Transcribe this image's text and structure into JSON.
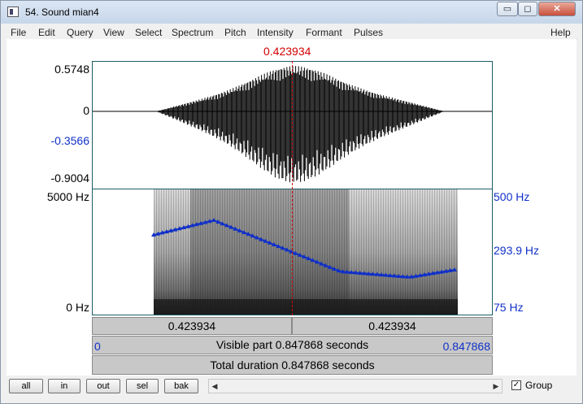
{
  "window": {
    "title": "54. Sound mian4",
    "minimize": "▭",
    "maximize": "◻",
    "close": "✕"
  },
  "menu": [
    "File",
    "Edit",
    "Query",
    "View",
    "Select",
    "Spectrum",
    "Pitch",
    "Intensity",
    "Formant",
    "Pulses"
  ],
  "help": "Help",
  "cursor_time": "0.423934",
  "waveform": {
    "y_max": "0.5748",
    "y_zero": "0",
    "y_cursor": "-0.3566",
    "y_min": "-0.9004"
  },
  "spectrogram": {
    "freq_max": "5000 Hz",
    "freq_min": "0 Hz",
    "pitch_max": "500 Hz",
    "pitch_value": "293.9 Hz",
    "pitch_min": "75 Hz"
  },
  "time_bar": {
    "left": "0.423934",
    "right": "0.423934"
  },
  "visible_bar": {
    "start": "0",
    "text": "Visible part 0.847868 seconds",
    "end": "0.847868"
  },
  "total_bar": {
    "text": "Total duration 0.847868 seconds"
  },
  "buttons": {
    "all": "all",
    "in": "in",
    "out": "out",
    "sel": "sel",
    "bak": "bak"
  },
  "group": {
    "label": "Group",
    "checked": "✓"
  },
  "colors": {
    "cursor": "#d40000",
    "pitch": "#1030c8",
    "frame": "#1c5e66"
  }
}
